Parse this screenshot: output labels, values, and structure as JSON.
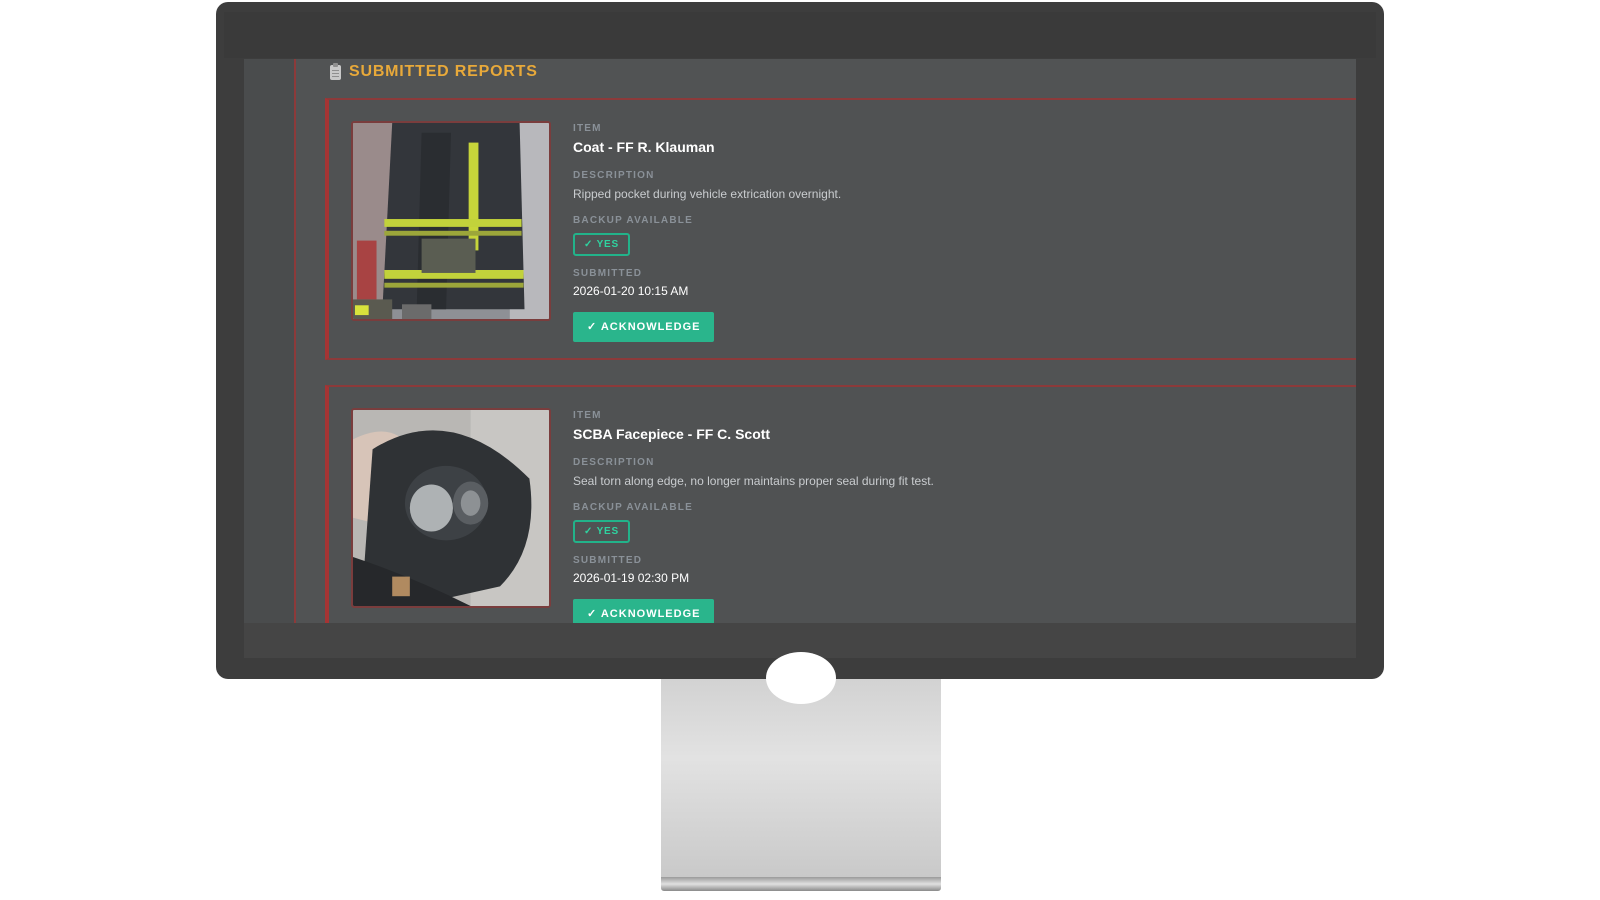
{
  "section": {
    "title": "SUBMITTED REPORTS",
    "icon": "clipboard-icon"
  },
  "labels": {
    "item": "ITEM",
    "description": "DESCRIPTION",
    "backup": "BACKUP AVAILABLE",
    "submitted": "SUBMITTED"
  },
  "reports": [
    {
      "item": "Coat - FF R. Klauman",
      "description": "Ripped pocket during vehicle extrication overnight.",
      "backup": "✓ YES",
      "submitted": "2026-01-20 10:15 AM",
      "action": "✓ ACKNOWLEDGE"
    },
    {
      "item": "SCBA Facepiece - FF C. Scott",
      "description": "Seal torn along edge, no longer maintains proper seal during fit test.",
      "backup": "✓ YES",
      "submitted": "2026-01-19 02:30 PM",
      "action": "✓ ACKNOWLEDGE"
    }
  ],
  "colors": {
    "accent_title": "#e8a93a",
    "accent_green": "#2ab58c",
    "accent_red": "#a53434"
  }
}
